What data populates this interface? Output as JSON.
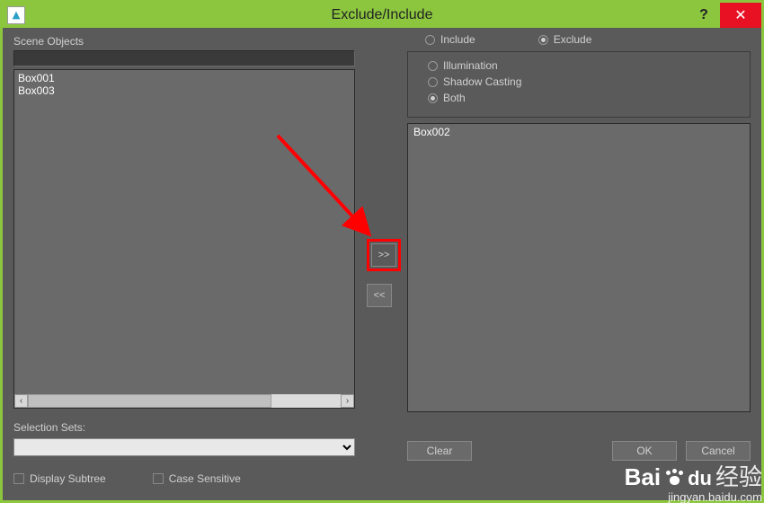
{
  "titlebar": {
    "title": "Exclude/Include",
    "help_symbol": "?",
    "close_symbol": "✕"
  },
  "left": {
    "scene_objects_label": "Scene Objects",
    "filter_value": "",
    "scene_items": [
      "Box001",
      "Box003"
    ],
    "selection_sets_label": "Selection Sets:",
    "display_subtree_label": "Display Subtree",
    "case_sensitive_label": "Case Sensitive"
  },
  "mid": {
    "add_label": ">>",
    "remove_label": "<<"
  },
  "right": {
    "include_label": "Include",
    "exclude_label": "Exclude",
    "illumination_label": "Illumination",
    "shadow_casting_label": "Shadow Casting",
    "both_label": "Both",
    "target_items": [
      "Box002"
    ],
    "clear_label": "Clear",
    "ok_label": "OK",
    "cancel_label": "Cancel"
  },
  "watermark": {
    "line1_a": "Bai",
    "line1_b": "du",
    "line1_c": "经验",
    "line2": "jingyan.baidu.com"
  }
}
